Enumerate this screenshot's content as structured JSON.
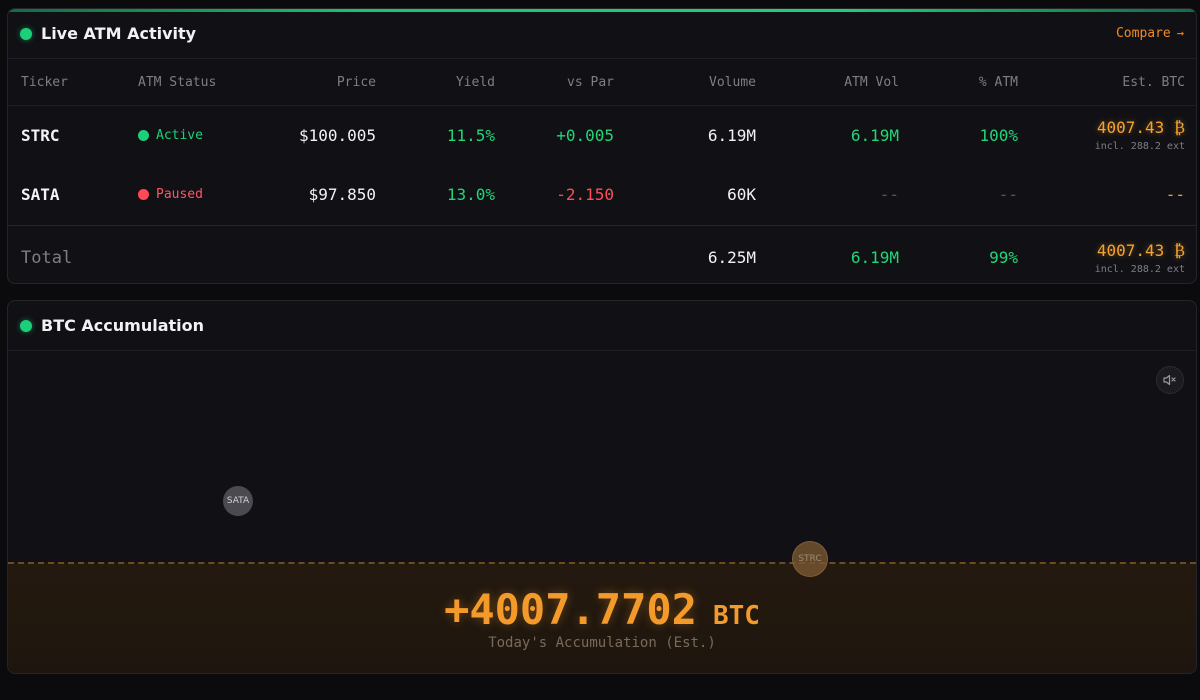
{
  "atm": {
    "title": "Live ATM Activity",
    "compare_label": "Compare",
    "compare_arrow": "→",
    "columns": [
      "Ticker",
      "ATM Status",
      "Price",
      "Yield",
      "vs Par",
      "Volume",
      "ATM Vol",
      "% ATM",
      "Est. BTC"
    ],
    "rows": [
      {
        "ticker": "STRC",
        "status": "Active",
        "price": "$100.005",
        "yield": "11.5%",
        "vs_par": "+0.005",
        "volume": "6.19M",
        "atm_vol": "6.19M",
        "pct_atm": "100%",
        "est_btc": "4007.43 ₿",
        "est_btc_sub": "incl. 288.2 ext"
      },
      {
        "ticker": "SATA",
        "status": "Paused",
        "price": "$97.850",
        "yield": "13.0%",
        "vs_par": "-2.150",
        "volume": "60K",
        "atm_vol": "--",
        "pct_atm": "--",
        "est_btc": "--"
      }
    ],
    "total": {
      "label": "Total",
      "volume": "6.25M",
      "atm_vol": "6.19M",
      "pct_atm": "99%",
      "est_btc": "4007.43 ₿",
      "est_btc_sub": "incl. 288.2 ext"
    }
  },
  "accumulation": {
    "title": "BTC Accumulation",
    "mute_icon": "speaker-muted-icon",
    "bubbles": [
      "SATA",
      "STRC"
    ],
    "value": "+4007.7702",
    "unit": "BTC",
    "caption": "Today's Accumulation (Est.)"
  },
  "colors": {
    "accent_green": "#1ad17a",
    "accent_orange": "#f49a2b",
    "negative_red": "#ff4d5a",
    "background": "#0b0b0e"
  }
}
